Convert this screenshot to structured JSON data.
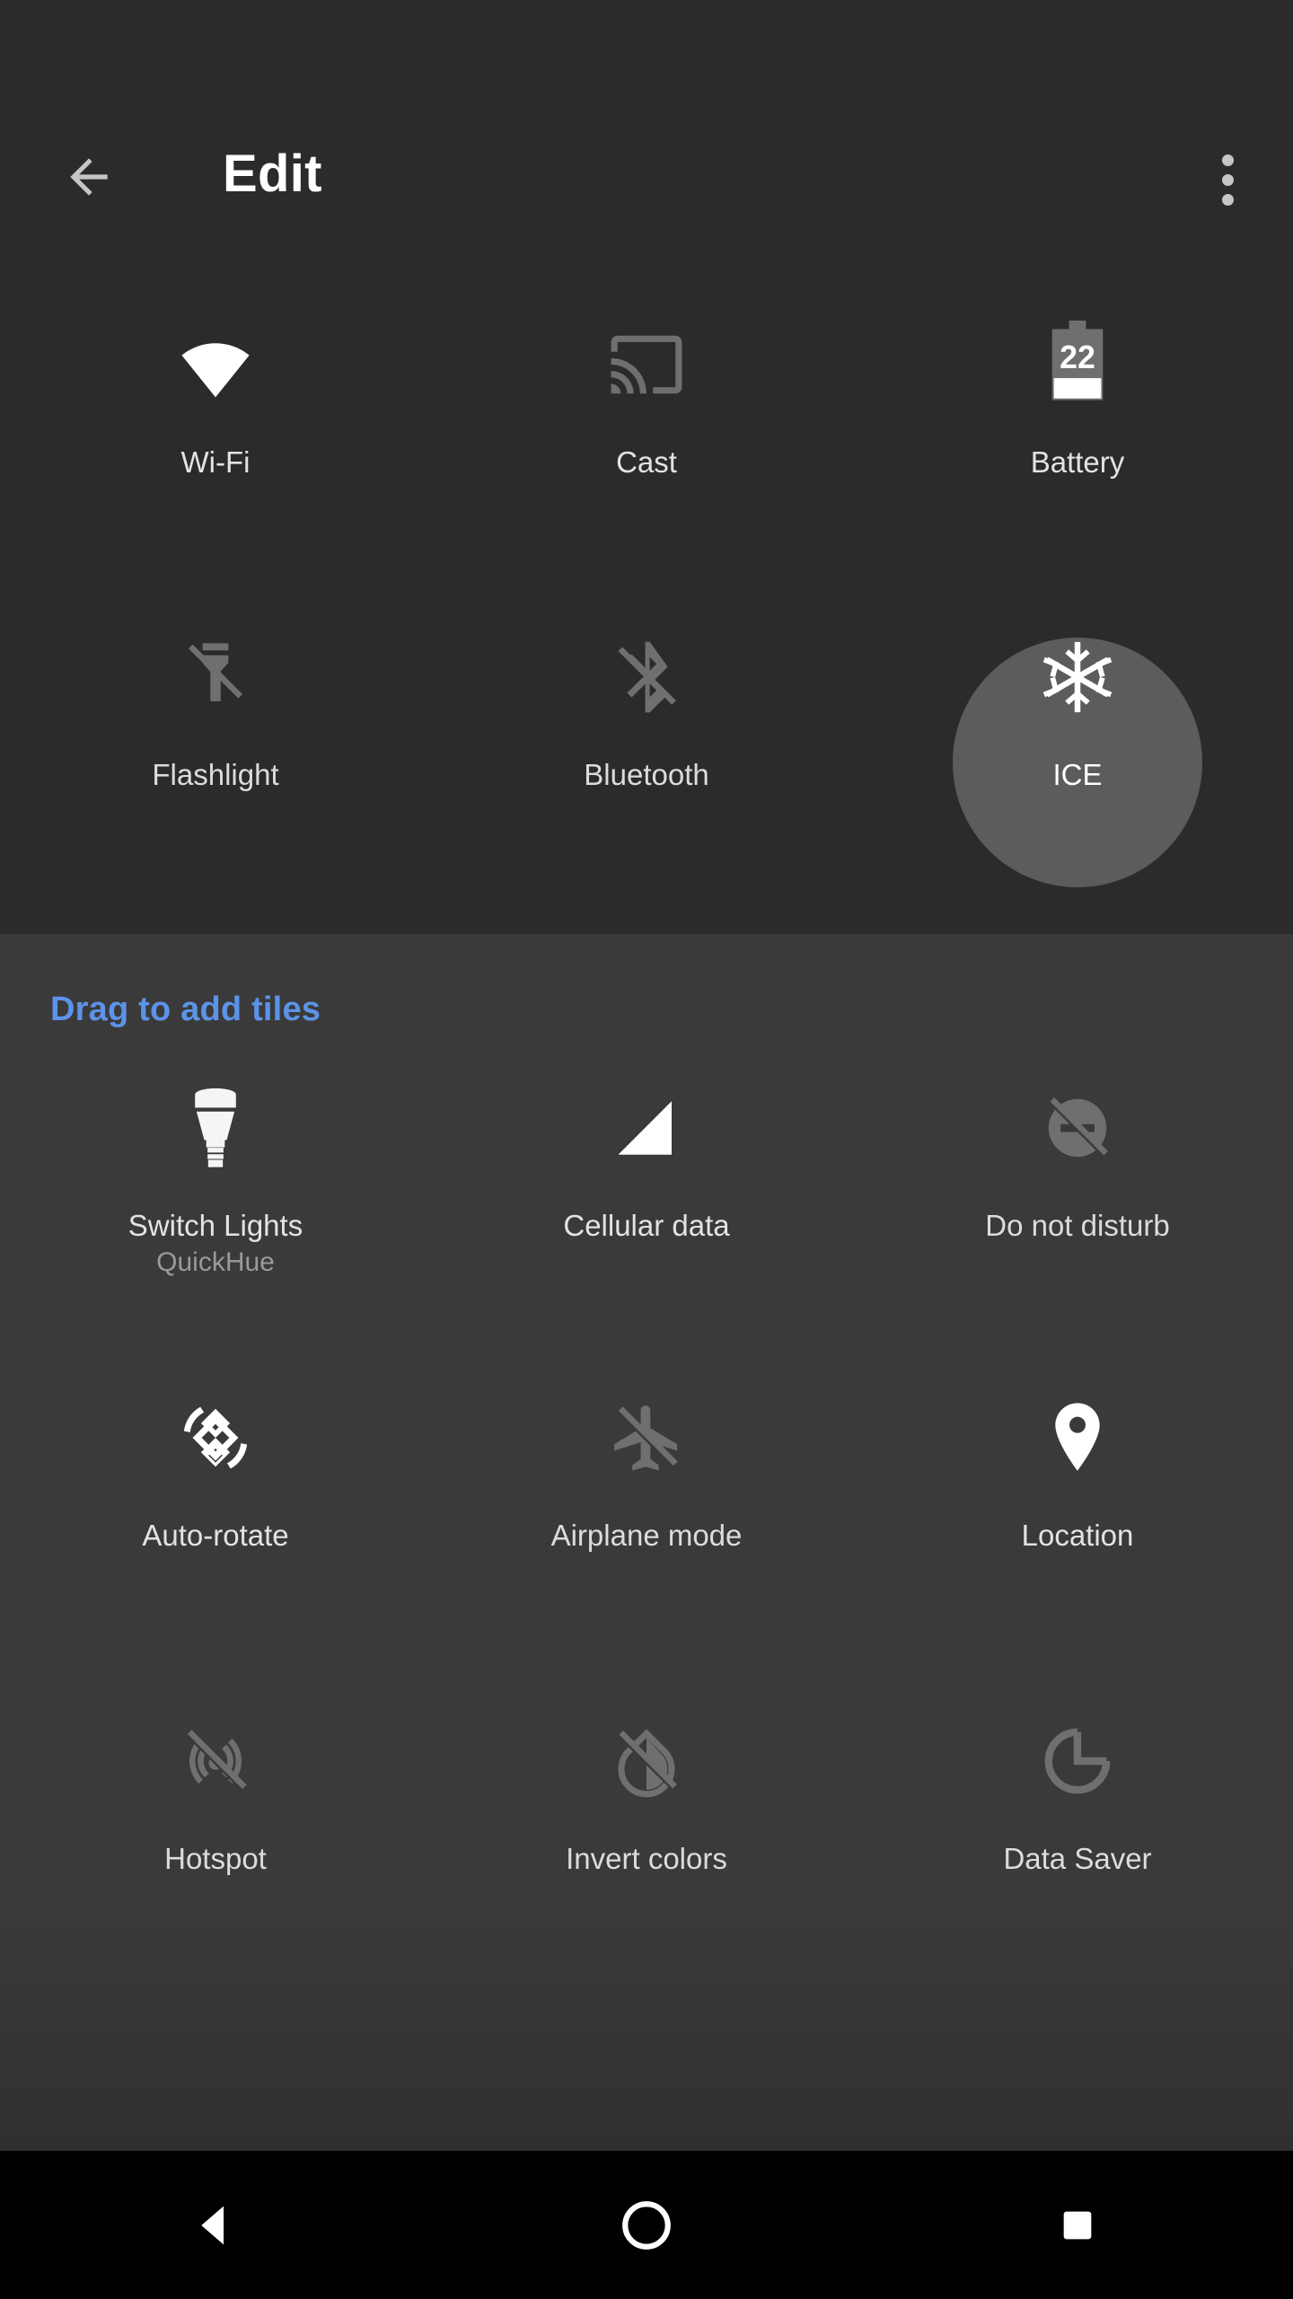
{
  "appbar": {
    "title": "Edit",
    "back_icon": "arrow-back-icon",
    "overflow_icon": "more-vert-icon"
  },
  "current_tiles": {
    "tiles": [
      {
        "label": "Wi-Fi",
        "icon": "wifi-icon",
        "state": "active"
      },
      {
        "label": "Cast",
        "icon": "cast-icon",
        "state": "inactive"
      },
      {
        "label": "Battery",
        "icon": "battery-icon",
        "state": "active",
        "battery_level": "22"
      },
      {
        "label": "Flashlight",
        "icon": "flashlight-off-icon",
        "state": "inactive"
      },
      {
        "label": "Bluetooth",
        "icon": "bluetooth-disabled-icon",
        "state": "inactive"
      },
      {
        "label": "ICE",
        "icon": "snowflake-icon",
        "state": "selected"
      }
    ]
  },
  "add_section": {
    "header": "Drag to add tiles",
    "header_color": "#5c93e8",
    "tiles": [
      {
        "label": "Switch Lights",
        "sublabel": "QuickHue",
        "icon": "lightbulb-icon",
        "state": "active"
      },
      {
        "label": "Cellular data",
        "icon": "signal-cellular-icon",
        "state": "active"
      },
      {
        "label": "Do not disturb",
        "icon": "do-not-disturb-off-icon",
        "state": "inactive"
      },
      {
        "label": "Auto-rotate",
        "icon": "screen-rotation-icon",
        "state": "active"
      },
      {
        "label": "Airplane mode",
        "icon": "airplane-icon",
        "state": "inactive"
      },
      {
        "label": "Location",
        "icon": "location-pin-icon",
        "state": "active"
      },
      {
        "label": "Hotspot",
        "icon": "hotspot-off-icon",
        "state": "inactive"
      },
      {
        "label": "Invert colors",
        "icon": "invert-colors-off-icon",
        "state": "inactive"
      },
      {
        "label": "Data Saver",
        "icon": "data-saver-icon",
        "state": "inactive"
      }
    ]
  },
  "navbar": {
    "back": "back-nav-icon",
    "home": "home-nav-icon",
    "recents": "recents-nav-icon"
  },
  "colors": {
    "top_background": "#2b2b2b",
    "add_background": "#3a3a3a",
    "navbar_background": "#000000",
    "accent_blue": "#5c93e8",
    "icon_active": "#ffffff",
    "icon_inactive": "#7a7a7a",
    "label": "#e3e3e3",
    "sublabel": "#9a9a9a",
    "highlight_circle": "#5c5c5c"
  }
}
